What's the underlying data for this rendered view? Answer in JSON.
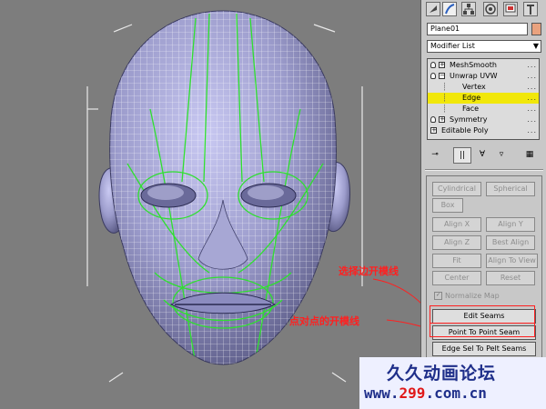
{
  "command_panel": {
    "tab_icons": [
      "create-icon",
      "modify-icon",
      "hierarchy-icon",
      "motion-icon",
      "display-icon",
      "utilities-icon"
    ],
    "object_name": "Plane01",
    "object_color": "#e9a27e",
    "modifier_list": "Modifier List",
    "stack": [
      {
        "label": "MeshSmooth",
        "level": 0
      },
      {
        "label": "Unwrap UVW",
        "level": 0
      },
      {
        "label": "Vertex",
        "level": 1
      },
      {
        "label": "Edge",
        "level": 1,
        "selected": true
      },
      {
        "label": "Face",
        "level": 1
      },
      {
        "label": "Symmetry",
        "level": 0
      },
      {
        "label": "Editable Poly",
        "level": 0
      }
    ],
    "stack_toolbar_icons": [
      "pin-stack-icon",
      "show-end-result-icon",
      "make-unique-icon",
      "remove-modifier-icon",
      "configure-modifier-sets-icon"
    ],
    "buttons": {
      "cylindrical": "Cylindrical",
      "spherical": "Spherical",
      "box": "Box",
      "align_x": "Align X",
      "align_y": "Align Y",
      "align_z": "Align Z",
      "best_align": "Best Align",
      "fit": "Fit",
      "align_to_view": "Align To View",
      "center": "Center",
      "reset": "Reset",
      "normalize_map": "Normalize Map",
      "edit_seams": "Edit Seams",
      "point_to_point_seam": "Point To Point Seam",
      "edge_sel_to_pelt_seams": "Edge Sel To Pelt Seams"
    },
    "selection_highlight": "#f1e70a"
  },
  "annotations": {
    "edit_seams_note": "选择边开模线",
    "point_seam_note": "点对点的开模线",
    "color": "#ff2020"
  },
  "watermark": {
    "title": "久久动画论坛",
    "url_prefix": "www.",
    "url_number": "299",
    "url_suffix": ".com.cn"
  }
}
